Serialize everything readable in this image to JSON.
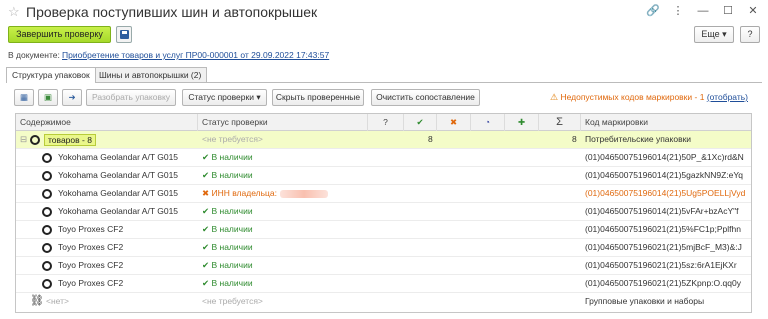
{
  "window": {
    "title": "Проверка поступивших шин и автопокрышек",
    "icons": {
      "link": "🔗",
      "more": "⋮",
      "minimize": "—",
      "maximize": "☐",
      "close": "✕"
    }
  },
  "commandbar": {
    "finish_label": "Завершить проверку",
    "more_label": "Еще",
    "help_label": "?"
  },
  "document": {
    "label": "В документе:",
    "link_text": "Приобретение товаров и услуг ПР00-000001 от 29.09.2022 17:43:57"
  },
  "tabs": [
    {
      "label": "Структура упаковок"
    },
    {
      "label": "Шины и автопокрышки (2)"
    }
  ],
  "toolbar": {
    "unpack_label": "Разобрать упаковку",
    "status_label": "Статус проверки",
    "hide_checked_label": "Скрыть проверенные",
    "clear_match_label": "Очистить сопоставление",
    "warning_text": "Недопустимых кодов маркировки - 1",
    "warning_link": "(отобрать)"
  },
  "table": {
    "headers": {
      "content": "Содержимое",
      "status": "Статус проверки",
      "question": "?",
      "check": "✔",
      "cross": "✖",
      "pie": "◔",
      "plus": "✚",
      "sigma": "Σ",
      "code": "Код маркировки"
    },
    "group_row": {
      "label": "товаров - 8",
      "status": "<не требуется>",
      "checked": "8",
      "total": "8",
      "code": "Потребительские упаковки"
    },
    "rows": [
      {
        "name": "Yokohama Geolandar A/T G015",
        "status": "В наличии",
        "code": "(01)04650075196014(21)50P_&1Xc)rd&N",
        "state": "ok"
      },
      {
        "name": "Yokohama Geolandar A/T G015",
        "status": "В наличии",
        "code": "(01)04650075196014(21)5gazkNN9Z:eYq",
        "state": "ok"
      },
      {
        "name": "Yokohama Geolandar A/T G015",
        "status": "ИНН владельца:",
        "code": "(01)04650075196014(21)5Ug5POELLjVyd",
        "state": "error"
      },
      {
        "name": "Yokohama Geolandar A/T G015",
        "status": "В наличии",
        "code": "(01)04650075196014(21)5vFAr+bzAcY\"f",
        "state": "ok"
      },
      {
        "name": "Toyo Proxes CF2",
        "status": "В наличии",
        "code": "(01)04650075196021(21)5%FC1p;Pplfhn",
        "state": "ok"
      },
      {
        "name": "Toyo Proxes CF2",
        "status": "В наличии",
        "code": "(01)04650075196021(21)5mjBcF_M3)&:J",
        "state": "ok"
      },
      {
        "name": "Toyo Proxes CF2",
        "status": "В наличии",
        "code": "(01)04650075196021(21)5sz:6rA1EjKXr",
        "state": "ok"
      },
      {
        "name": "Toyo Proxes CF2",
        "status": "В наличии",
        "code": "(01)04650075196021(21)5ZKpnp:O.qq0y",
        "state": "ok"
      }
    ],
    "footer_row": {
      "name": "<нет>",
      "status": "<не требуется>",
      "code": "Групповые упаковки и наборы"
    }
  },
  "colors": {
    "accent_green": "#a6d92a",
    "status_ok": "#2e8b2e",
    "status_error": "#e0690e",
    "link": "#1f4e99",
    "group_bg": "#f4fcc8"
  }
}
